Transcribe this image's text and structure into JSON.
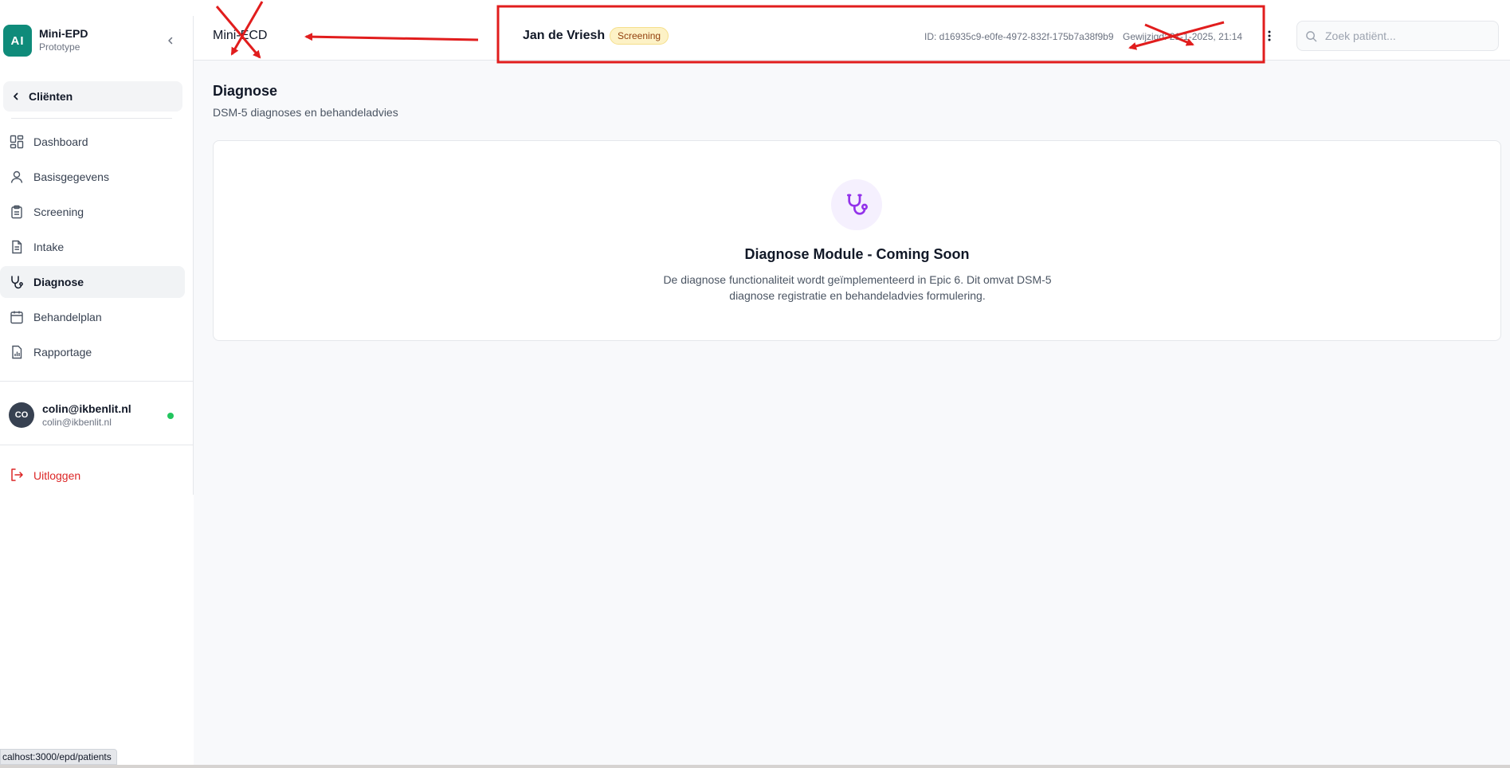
{
  "sidebar": {
    "brand": {
      "logo": "AI",
      "title": "Mini-EPD",
      "subtitle": "Prototype"
    },
    "back_label": "Cliënten",
    "items": [
      {
        "label": "Dashboard",
        "icon": "dashboard-icon",
        "active": false
      },
      {
        "label": "Basisgegevens",
        "icon": "user-icon",
        "active": false
      },
      {
        "label": "Screening",
        "icon": "clipboard-icon",
        "active": false
      },
      {
        "label": "Intake",
        "icon": "document-icon",
        "active": false
      },
      {
        "label": "Diagnose",
        "icon": "stethoscope-icon",
        "active": true
      },
      {
        "label": "Behandelplan",
        "icon": "calendar-icon",
        "active": false
      },
      {
        "label": "Rapportage",
        "icon": "report-icon",
        "active": false
      }
    ],
    "user": {
      "initials": "CO",
      "name": "colin@ikbenlit.nl",
      "email": "colin@ikbenlit.nl",
      "status": "online"
    },
    "logout_label": "Uitloggen"
  },
  "header": {
    "app_name": "Mini-ECD",
    "patient_name": "Jan de Vriesh",
    "status_badge": "Screening",
    "patient_id": "ID: d16935c9-e0fe-4972-832f-175b7a38f9b9",
    "modified": "Gewijzigd: 21-1-2025, 21:14",
    "search_placeholder": "Zoek patiënt..."
  },
  "main": {
    "title": "Diagnose",
    "subtitle": "DSM-5 diagnoses en behandeladvies",
    "card": {
      "icon": "stethoscope-icon",
      "title": "Diagnose Module - Coming Soon",
      "text": "De diagnose functionaliteit wordt geïmplementeerd in Epic 6. Dit omvat DSM-5 diagnose registratie en behandeladvies formulering."
    }
  },
  "status_bar": {
    "url": "calhost:3000/epd/patients"
  },
  "colors": {
    "brand": "#0f8b7a",
    "active_nav_bg": "#f1f3f5",
    "badge_bg": "#fdf2c6",
    "logout": "#dc2626",
    "online": "#22c55e",
    "icon_accent": "#9333ea",
    "annotation": "#e11d1d"
  }
}
